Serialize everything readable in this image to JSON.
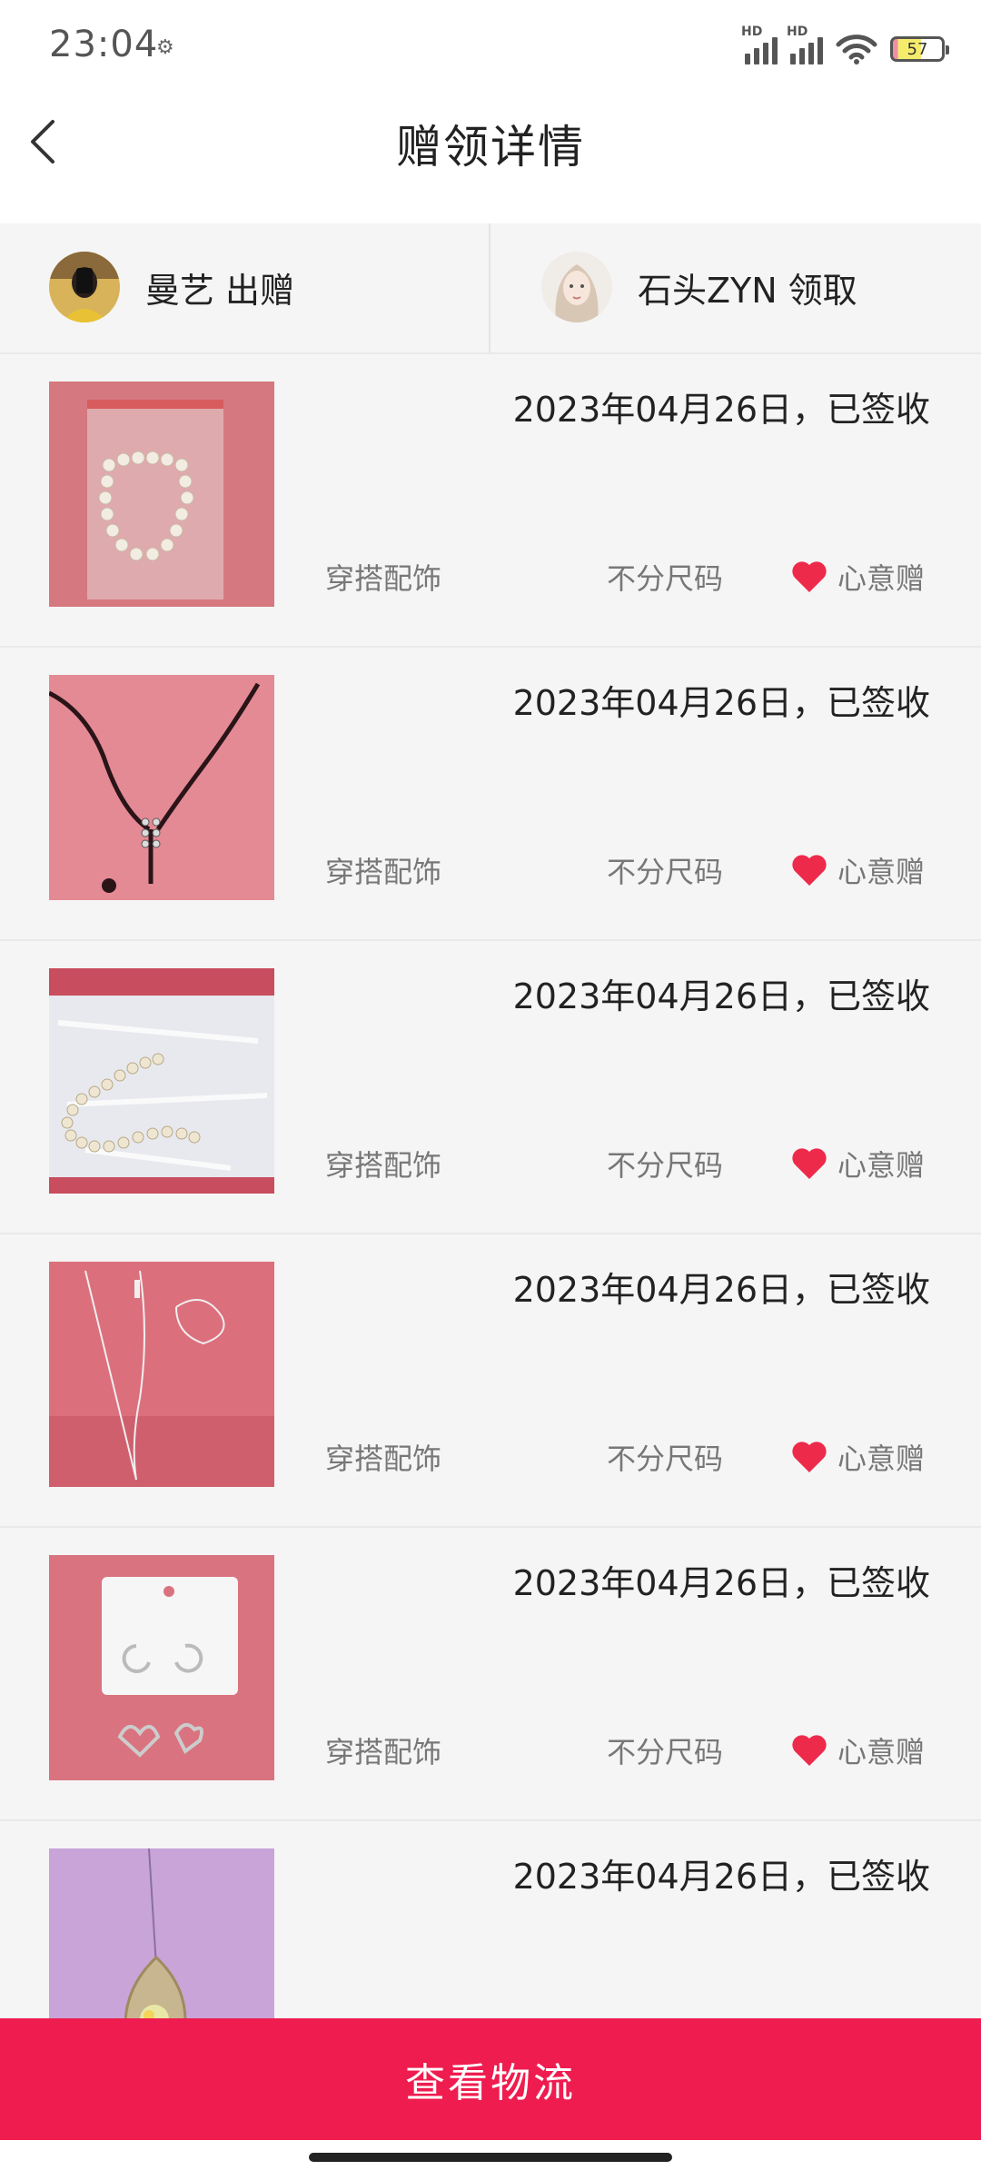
{
  "status_bar": {
    "time": "23:04",
    "signal_label_1": "HD",
    "signal_label_2": "HD",
    "battery": "57"
  },
  "nav": {
    "title": "赠领详情",
    "back_icon": "chevron-left-icon"
  },
  "participants": {
    "giver": {
      "name": "曼艺",
      "role": "出赠"
    },
    "receiver": {
      "name": "石头ZYN",
      "role": "领取"
    }
  },
  "items": [
    {
      "date_status": "2023年04月26日，已签收",
      "category": "穿搭配饰",
      "size": "不分尺码",
      "type": "心意赠"
    },
    {
      "date_status": "2023年04月26日，已签收",
      "category": "穿搭配饰",
      "size": "不分尺码",
      "type": "心意赠"
    },
    {
      "date_status": "2023年04月26日，已签收",
      "category": "穿搭配饰",
      "size": "不分尺码",
      "type": "心意赠"
    },
    {
      "date_status": "2023年04月26日，已签收",
      "category": "穿搭配饰",
      "size": "不分尺码",
      "type": "心意赠"
    },
    {
      "date_status": "2023年04月26日，已签收",
      "category": "穿搭配饰",
      "size": "不分尺码",
      "type": "心意赠"
    },
    {
      "date_status": "2023年04月26日，已签收",
      "category": "",
      "size": "",
      "type": ""
    }
  ],
  "bottom_button": {
    "label": "查看物流"
  },
  "colors": {
    "accent": "#ef1c4f",
    "heart": "#ee2a4b",
    "background": "#f5f5f5"
  }
}
